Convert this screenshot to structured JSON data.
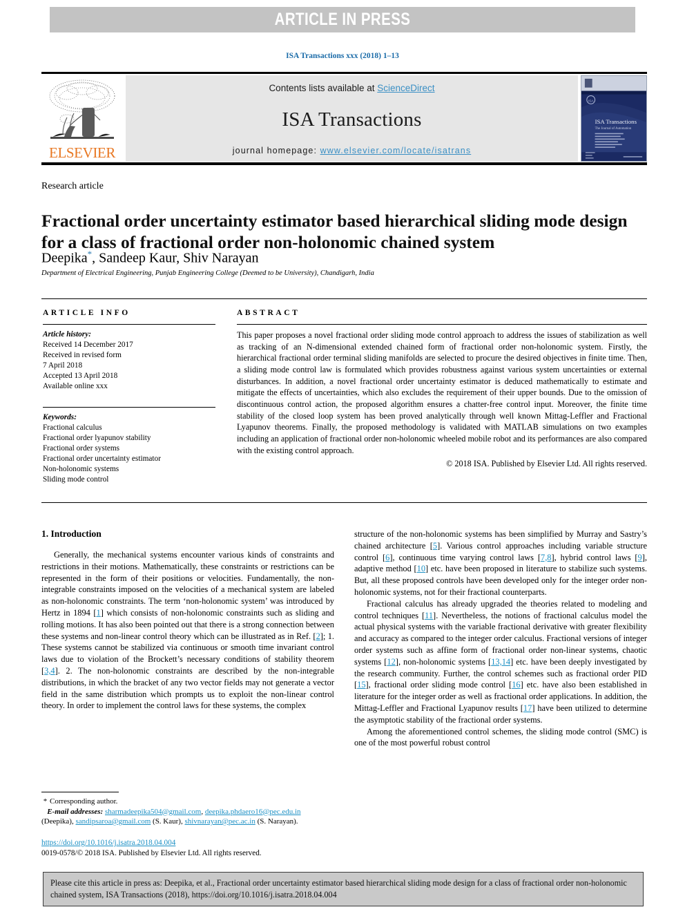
{
  "banner": {
    "text": "ARTICLE IN PRESS"
  },
  "running_head": "ISA Transactions xxx (2018) 1–13",
  "masthead": {
    "contents_prefix": "Contents lists available at ",
    "contents_link": "ScienceDirect",
    "journal_title": "ISA Transactions",
    "homepage_prefix": "journal homepage: ",
    "homepage_url": "www.elsevier.com/locate/isatrans",
    "publisher_wordmark": "ELSEVIER",
    "cover_title": "ISA Transactions",
    "cover_subtitle": "The Journal of Automation"
  },
  "article": {
    "type": "Research article",
    "title": "Fractional order uncertainty estimator based hierarchical sliding mode design for a class of fractional order non-holonomic chained system",
    "authors_pre": "Deepika",
    "corresponding_marker": "*",
    "authors_post": ", Sandeep Kaur, Shiv Narayan",
    "affiliation": "Department of Electrical Engineering, Punjab Engineering College (Deemed to be University), Chandigarh, India"
  },
  "article_info": {
    "heading": "ARTICLE INFO",
    "history_label": "Article history:",
    "history": [
      "Received 14 December 2017",
      "Received in revised form",
      "7 April 2018",
      "Accepted 13 April 2018",
      "Available online xxx"
    ],
    "keywords_label": "Keywords:",
    "keywords": [
      "Fractional calculus",
      "Fractional order lyapunov stability",
      "Fractional order systems",
      "Fractional order uncertainty estimator",
      "Non-holonomic systems",
      "Sliding mode control"
    ]
  },
  "abstract": {
    "heading": "ABSTRACT",
    "text": "This paper proposes a novel fractional order sliding mode control approach to address the issues of stabilization as well as tracking of an N-dimensional extended chained form of fractional order non-holonomic system. Firstly, the hierarchical fractional order terminal sliding manifolds are selected to procure the desired objectives in finite time. Then, a sliding mode control law is formulated which provides robustness against various system uncertainties or external disturbances. In addition, a novel fractional order uncertainty estimator is deduced mathematically to estimate and mitigate the effects of uncertainties, which also excludes the requirement of their upper bounds. Due to the omission of discontinuous control action, the proposed algorithm ensures a chatter-free control input. Moreover, the finite time stability of the closed loop system has been proved analytically through well known Mittag-Leffler and Fractional Lyapunov theorems. Finally, the proposed methodology is validated with MATLAB simulations on two examples including an application of fractional order non-holonomic wheeled mobile robot and its performances are also compared with the existing control approach.",
    "copyright": "© 2018 ISA. Published by Elsevier Ltd. All rights reserved."
  },
  "body": {
    "section_title": "1. Introduction",
    "left_paragraph_1_a": "Generally, the mechanical systems encounter various kinds of constraints and restrictions in their motions. Mathematically, these constraints or restrictions can be represented in the form of their positions or velocities. Fundamentally, the non-integrable constraints imposed on the velocities of a mechanical system are labeled as non-holonomic constraints. The term ‘non-holonomic system’ was introduced by Hertz in 1894 ",
    "ref_1": "1",
    "left_paragraph_1_b": " which consists of non-holonomic constraints such as sliding and rolling motions. It has also been pointed out that there is a strong connection between these systems and non-linear control theory which can be illustrated as in Ref. ",
    "ref_2": "2",
    "left_paragraph_1_c": "; 1. These systems cannot be stabilized via continuous or smooth time invariant control laws due to violation of the Brockett’s necessary conditions of stability theorem ",
    "ref_34": "3,4",
    "left_paragraph_1_d": ". 2. The non-holonomic constraints are described by the non-integrable distributions, in which the bracket of any two vector fields may not generate a vector field in the same distribution which prompts us to exploit the non-linear control theory. In order to implement the control laws for these systems, the complex",
    "right_paragraph_1_a": "structure of the non-holonomic systems has been simplified by Murray and Sastry’s chained architecture ",
    "ref_5": "5",
    "right_paragraph_1_b": ". Various control approaches including variable structure control ",
    "ref_6": "6",
    "right_paragraph_1_c": ", continuous time varying control laws ",
    "ref_78": "7,8",
    "right_paragraph_1_d": ", hybrid control laws ",
    "ref_9": "9",
    "right_paragraph_1_e": ", adaptive method ",
    "ref_10": "10",
    "right_paragraph_1_f": " etc. have been proposed in literature to stabilize such systems. But, all these proposed controls have been developed only for the integer order non-holonomic systems, not for their fractional counterparts.",
    "right_paragraph_2_a": "Fractional calculus has already upgraded the theories related to modeling and control techniques ",
    "ref_11": "11",
    "right_paragraph_2_b": ". Nevertheless, the notions of fractional calculus model the actual physical systems with the variable fractional derivative with greater flexibility and accuracy as compared to the integer order calculus. Fractional versions of integer order systems such as affine form of fractional order non-linear systems, chaotic systems ",
    "ref_12": "12",
    "right_paragraph_2_c": ", non-holonomic systems ",
    "ref_1314": "13,14",
    "right_paragraph_2_d": " etc. have been deeply investigated by the research community. Further, the control schemes such as fractional order PID ",
    "ref_15": "15",
    "right_paragraph_2_e": ", fractional order sliding mode control ",
    "ref_16": "16",
    "right_paragraph_2_f": " etc. have also been established in literature for the integer order as well as fractional order applications. In addition, the Mittag-Leffler and Fractional Lyapunov results ",
    "ref_17": "17",
    "right_paragraph_2_g": " have been utilized to determine the asymptotic stability of the fractional order systems.",
    "right_paragraph_3": "Among the aforementioned control schemes, the sliding mode control (SMC) is one of the most powerful robust control"
  },
  "footnotes": {
    "corresponding_star": "*",
    "corresponding_text": "Corresponding author.",
    "email_label": "E-mail addresses:",
    "email_1": "sharmadeepika504@gmail.com",
    "email_2": "deepika.phdaero16@pec.edu.in",
    "email_1_owner": " (Deepika), ",
    "email_3": "sandipsaroa@gmail.com",
    "email_3_owner": " (S. Kaur), ",
    "email_4": "shivnarayan@pec.ac.in",
    "email_4_owner": " (S. Narayan).",
    "doi_url": "https://doi.org/10.1016/j.isatra.2018.04.004",
    "issn_line": "0019-0578/© 2018 ISA. Published by Elsevier Ltd. All rights reserved."
  },
  "cite_box": {
    "text": "Please cite this article in press as: Deepika, et al., Fractional order uncertainty estimator based hierarchical sliding mode design for a class of fractional order non-holonomic chained system, ISA Transactions (2018), https://doi.org/10.1016/j.isatra.2018.04.004"
  },
  "colors": {
    "banner_bg": "#c3c3c3",
    "link_blue": "#1a8fc4",
    "running_head_blue": "#1a6ba8",
    "elsevier_orange": "#e87722",
    "masthead_grey": "#e6e6e6",
    "cite_box_grey": "#c9c9c9",
    "cover_navy": "#1b2a63"
  }
}
